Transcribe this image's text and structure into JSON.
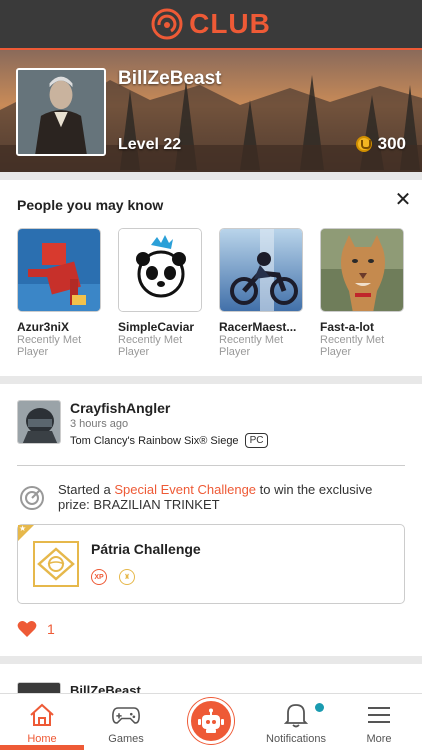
{
  "header": {
    "brand": "CLUB"
  },
  "profile": {
    "username": "BillZeBeast",
    "level": "Level 22",
    "units": "300"
  },
  "people_section": {
    "title": "People you may know",
    "people": [
      {
        "name": "Azur3niX",
        "subtitle": "Recently Met Player"
      },
      {
        "name": "SimpleCaviar",
        "subtitle": "Recently Met Player"
      },
      {
        "name": "RacerMaest...",
        "subtitle": "Recently Met Player"
      },
      {
        "name": "Fast-a-lot",
        "subtitle": "Recently Met Player"
      }
    ]
  },
  "feed": {
    "post": {
      "author": "CrayfishAngler",
      "time": "3 hours ago",
      "game": "Tom Clancy's Rainbow Six® Siege",
      "platform": "PC",
      "activity_prefix": "Started a ",
      "activity_link": "Special Event Challenge",
      "activity_suffix": " to win the exclusive prize: BRAZILIAN TRINKET",
      "challenge_title": "Pátria Challenge",
      "reward_xp": "XP",
      "likes": "1"
    },
    "next_post_author": "BillZeBeast"
  },
  "nav": {
    "home": "Home",
    "games": "Games",
    "notifications": "Notifications",
    "more": "More"
  },
  "colors": {
    "accent": "#ee5a36",
    "gold": "#e6b84b",
    "topbar": "#3a3a3a",
    "notif_dot": "#1a9bb0"
  },
  "icons": [
    "ubisoft-logo-icon",
    "coin-icon",
    "close-icon",
    "target-icon",
    "star-icon",
    "heart-icon",
    "home-icon",
    "gamepad-icon",
    "robot-icon",
    "bell-icon",
    "menu-icon"
  ]
}
